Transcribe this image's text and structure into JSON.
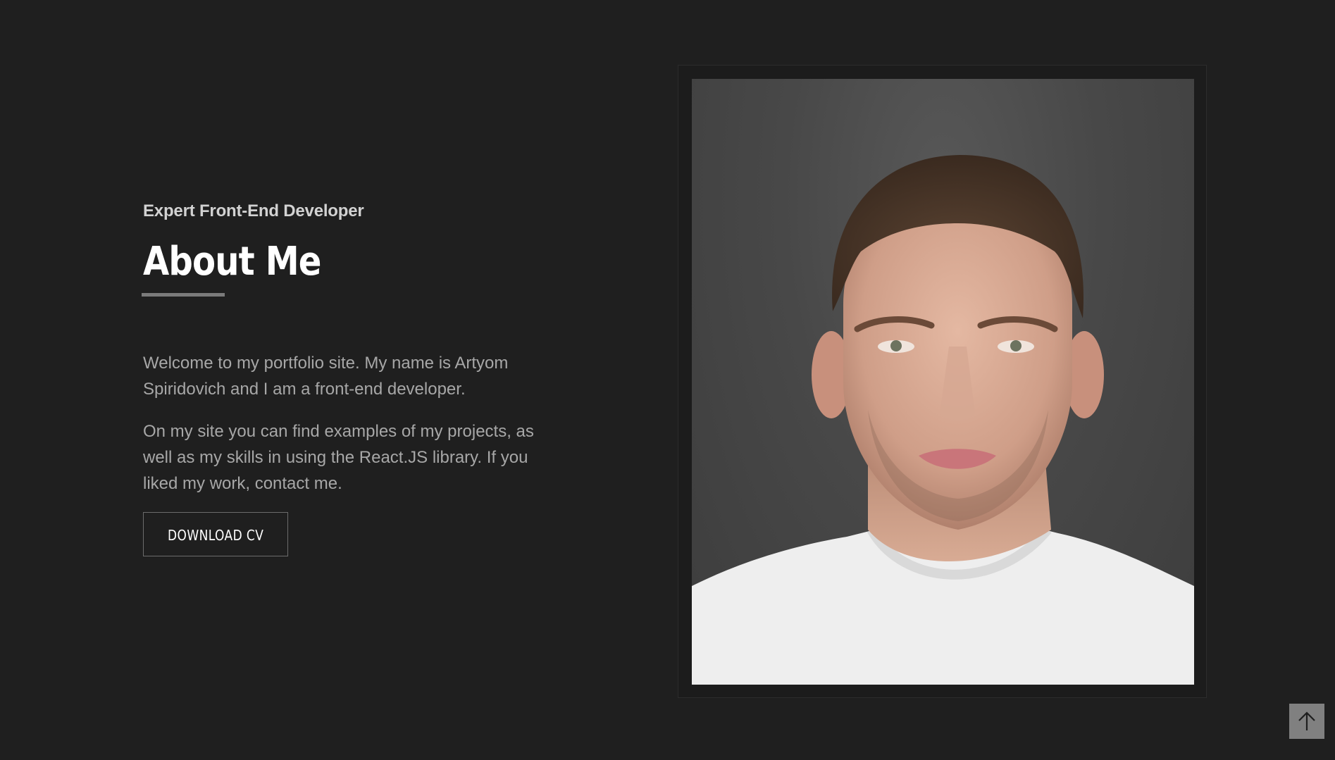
{
  "about": {
    "subtitle": "Expert Front-End Developer",
    "title": "About Me",
    "paragraphs": [
      "Welcome to my portfolio site. My name is Artyom Spiridovich and I am a front-end developer.",
      "On my site you can find examples of my projects, as well as my skills in using the React.JS library. If you liked my work, contact me."
    ],
    "download_label": "DOWNLOAD CV"
  },
  "photo": {
    "subject": "portrait"
  },
  "scroll_top": {
    "icon": "arrow-up-icon"
  },
  "colors": {
    "background": "#1f1f1f",
    "accent": "#7a7a7a",
    "text_muted": "#a7a7a7"
  }
}
